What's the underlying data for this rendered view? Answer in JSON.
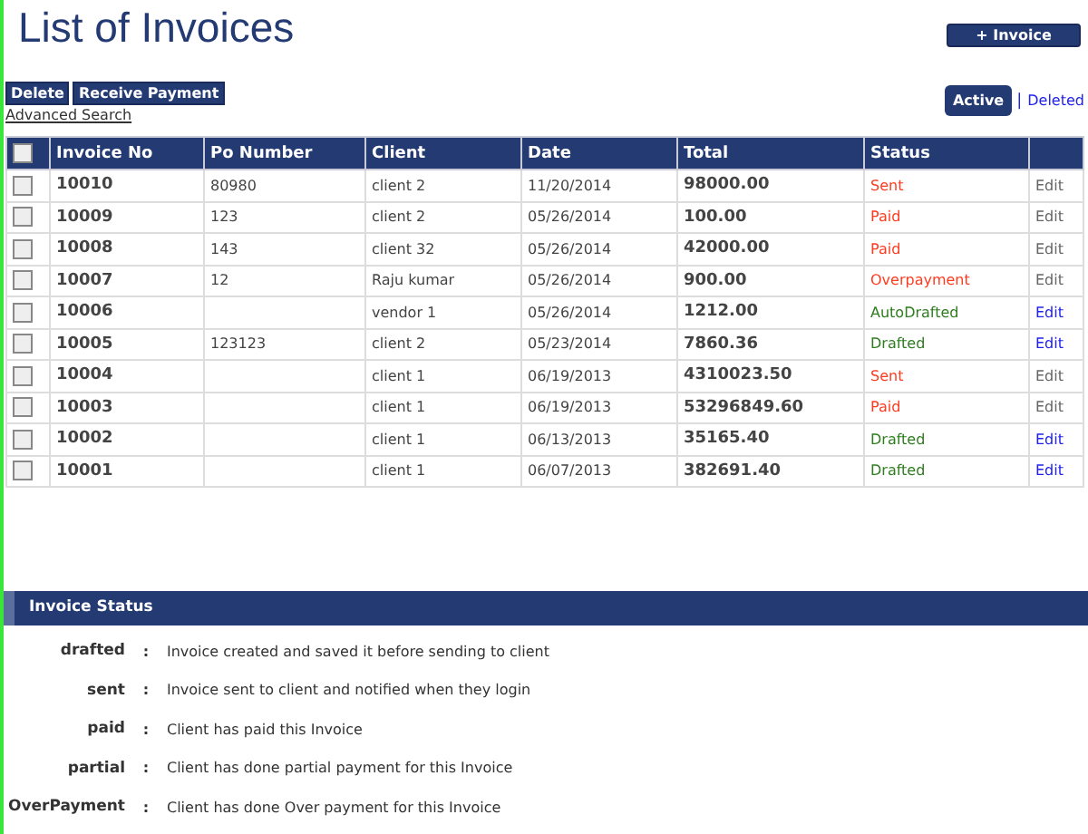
{
  "title": "List of Invoices",
  "new_button": "+ Invoice",
  "actions": [
    "Delete",
    "Receive Payment"
  ],
  "advanced_search": "Advanced Search",
  "filters": [
    {
      "label": "Active",
      "selected": true
    },
    {
      "label": "Deleted",
      "selected": false
    }
  ],
  "filter_separator": "|",
  "table": {
    "select_all": {
      "checked": false
    },
    "columns": [
      "Invoice No",
      "Po Number",
      "Client",
      "Date",
      "Total",
      "Status"
    ],
    "rows": [
      {
        "checked": false,
        "invoice_no": "10010",
        "po_number": "80980",
        "client": "client 2",
        "date": "11/20/2014",
        "total": "98000.00",
        "status": "Sent",
        "color": "#ff3b1f",
        "action": "Edit",
        "editable": false
      },
      {
        "checked": false,
        "invoice_no": "10009",
        "po_number": "123",
        "client": "client 2",
        "date": "05/26/2014",
        "total": "100.00",
        "status": "Paid",
        "color": "#ff3b1f",
        "action": "Edit",
        "editable": false
      },
      {
        "checked": false,
        "invoice_no": "10008",
        "po_number": "143",
        "client": "client 32",
        "date": "05/26/2014",
        "total": "42000.00",
        "status": "Paid",
        "color": "#ff3b1f",
        "action": "Edit",
        "editable": false
      },
      {
        "checked": false,
        "invoice_no": "10007",
        "po_number": "12",
        "client": "Raju kumar",
        "date": "05/26/2014",
        "total": "900.00",
        "status": "Overpayment",
        "color": "#ff3b1f",
        "action": "Edit",
        "editable": false
      },
      {
        "checked": false,
        "invoice_no": "10006",
        "client": "vendor 1",
        "date": "05/26/2014",
        "total": "1212.00",
        "status": "AutoDrafted",
        "color": "#2e7d1e",
        "action": "Edit",
        "editable": true
      },
      {
        "checked": false,
        "invoice_no": "10005",
        "po_number": "123123",
        "client": "client 2",
        "date": "05/23/2014",
        "total": "7860.36",
        "status": "Drafted",
        "color": "#2e7d1e",
        "action": "Edit",
        "editable": true
      },
      {
        "checked": false,
        "invoice_no": "10004",
        "client": "client 1",
        "date": "06/19/2013",
        "total": "4310023.50",
        "status": "Sent",
        "color": "#ff3b1f",
        "action": "Edit",
        "editable": false
      },
      {
        "checked": false,
        "invoice_no": "10003",
        "client": "client 1",
        "date": "06/19/2013",
        "total": "53296849.60",
        "status": "Paid",
        "color": "#ff3b1f",
        "action": "Edit",
        "editable": false
      },
      {
        "checked": false,
        "invoice_no": "10002",
        "client": "client 1",
        "date": "06/13/2013",
        "total": "35165.40",
        "status": "Drafted",
        "color": "#2e7d1e",
        "action": "Edit",
        "editable": true
      },
      {
        "checked": false,
        "invoice_no": "10001",
        "client": "client 1",
        "date": "06/07/2013",
        "total": "382691.40",
        "status": "Drafted",
        "color": "#2e7d1e",
        "action": "Edit",
        "editable": true
      }
    ]
  },
  "legend": {
    "title": "Invoice Status",
    "items": [
      {
        "term": "drafted",
        "separator": ":",
        "description": "Invoice created and saved it before sending to client"
      },
      {
        "term": "sent",
        "separator": ":",
        "description": "Invoice sent to client and notified when they login"
      },
      {
        "term": "paid",
        "separator": ":",
        "description": "Client has paid this Invoice"
      },
      {
        "term": "partial",
        "separator": ":",
        "description": "Client has done partial payment for this Invoice"
      },
      {
        "term": "OverPayment",
        "separator": ":",
        "description": "Client has done Over payment for this Invoice"
      }
    ]
  }
}
